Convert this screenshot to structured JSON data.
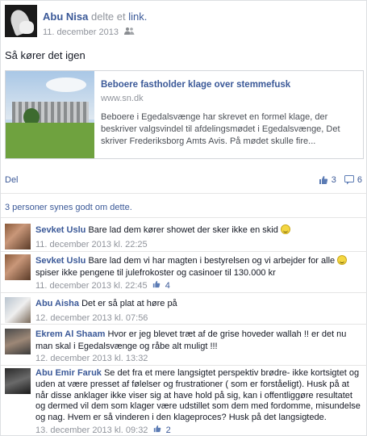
{
  "post": {
    "author": "Abu Nisa",
    "shared_text": "delte et",
    "shared_link": "link.",
    "date": "11. december 2013",
    "text": "Så kører det igen",
    "link_card": {
      "title": "Beboere fastholder klage over stemmefusk",
      "domain": "www.sn.dk",
      "description": "Beboere i Egedalsvænge har skrevet en formel klage, der beskriver valgsvindel til afdelingsmødet i Egedalsvænge, Det skriver Frederiksborg Amts Avis. På mødet skulle fire..."
    },
    "actions": {
      "share_label": "Del",
      "like_count": "3",
      "comment_count": "6"
    },
    "likes_summary": "3 personer synes godt om dette."
  },
  "comments": [
    {
      "name": "Sevket Uslu",
      "text": "Bare lad dem kører showet der sker ikke en skid",
      "timestamp": "11. december 2013 kl. 22:25",
      "likes": "",
      "has_smiley": true
    },
    {
      "name": "Sevket Uslu",
      "text": "Bare lad dem vi har magten i bestyrelsen og vi arbejder for alle",
      "text_after": "spiser ikke pengene til julefrokoster og casinoer til 130.000 kr",
      "timestamp": "11. december 2013 kl. 22:45",
      "likes": "4",
      "has_smiley": true
    },
    {
      "name": "Abu Aisha",
      "text": "Det er så plat at høre på",
      "timestamp": "12. december 2013 kl. 07:56",
      "likes": ""
    },
    {
      "name": "Ekrem Al Shaam",
      "text": "Hvor er jeg blevet træt af de grise hoveder wallah !! er det nu man skal i Egedalsvænge og råbe alt muligt !!!",
      "timestamp": "12. december 2013 kl. 13:32",
      "likes": ""
    },
    {
      "name": "Abu Emir Faruk",
      "text": "Se det fra et mere langsigtet perspektiv brødre- ikke kortsigtet og uden at være presset af følelser og frustrationer ( som er forståeligt). Husk på at når disse anklager ikke viser sig at have hold på sig, kan i offentliggøre resultatet og dermed vil dem som klager være udstillet som dem med fordomme, misundelse og nag. Hvem er så vinderen i den klageproces? Husk på det langsigtede.",
      "timestamp": "13. december 2013 kl. 09:32",
      "likes": "2"
    }
  ],
  "colors": {
    "link": "#3b5998",
    "meta": "#90949c",
    "border": "#dddfe2"
  }
}
